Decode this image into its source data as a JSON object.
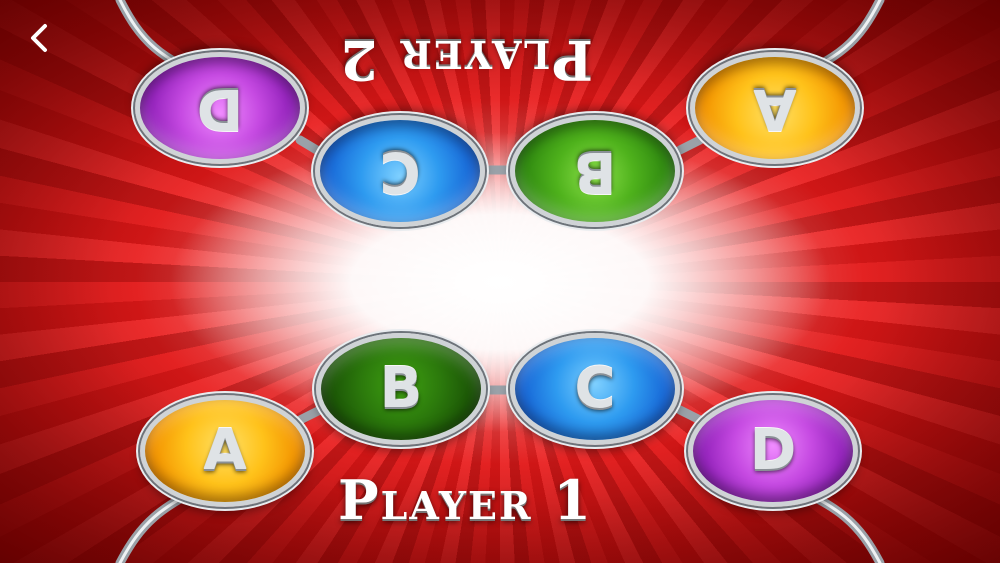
{
  "nav": {
    "back_icon": "chevron-left-icon"
  },
  "player1": {
    "label": "Player 1",
    "buttons": [
      {
        "letter": "A",
        "color": "#f7a600"
      },
      {
        "letter": "B",
        "color": "#2e7a0c"
      },
      {
        "letter": "C",
        "color": "#1f7ee8"
      },
      {
        "letter": "D",
        "color": "#a12ed0"
      }
    ]
  },
  "player2": {
    "label": "Player 2",
    "buttons": [
      {
        "letter": "A",
        "color": "#f7a600"
      },
      {
        "letter": "B",
        "color": "#3fa51a"
      },
      {
        "letter": "C",
        "color": "#1f7ee8"
      },
      {
        "letter": "D",
        "color": "#a12ed0"
      }
    ]
  },
  "theme": {
    "background": "#c8101a",
    "center_glow": "#ffffff",
    "wire": "#d0d4d8"
  }
}
